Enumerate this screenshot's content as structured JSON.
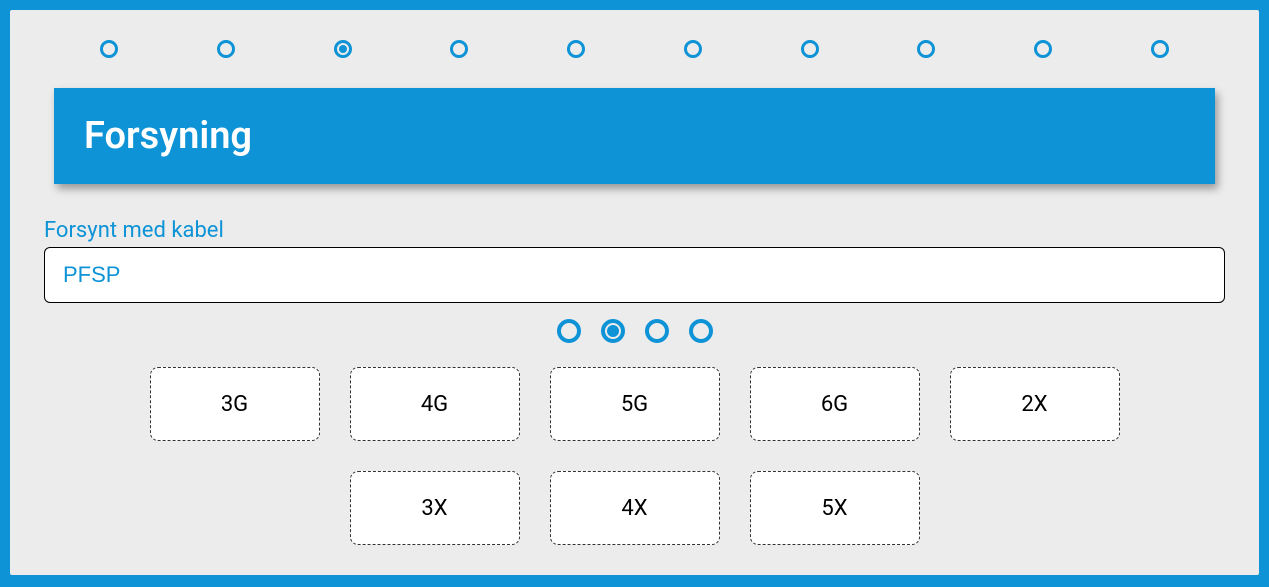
{
  "stepper": {
    "total": 10,
    "activeIndex": 2
  },
  "header": {
    "title": "Forsyning"
  },
  "field": {
    "label": "Forsynt med kabel",
    "value": "PFSP"
  },
  "subStepper": {
    "total": 4,
    "activeIndex": 1
  },
  "options": [
    "3G",
    "4G",
    "5G",
    "6G",
    "2X",
    "3X",
    "4X",
    "5X"
  ]
}
